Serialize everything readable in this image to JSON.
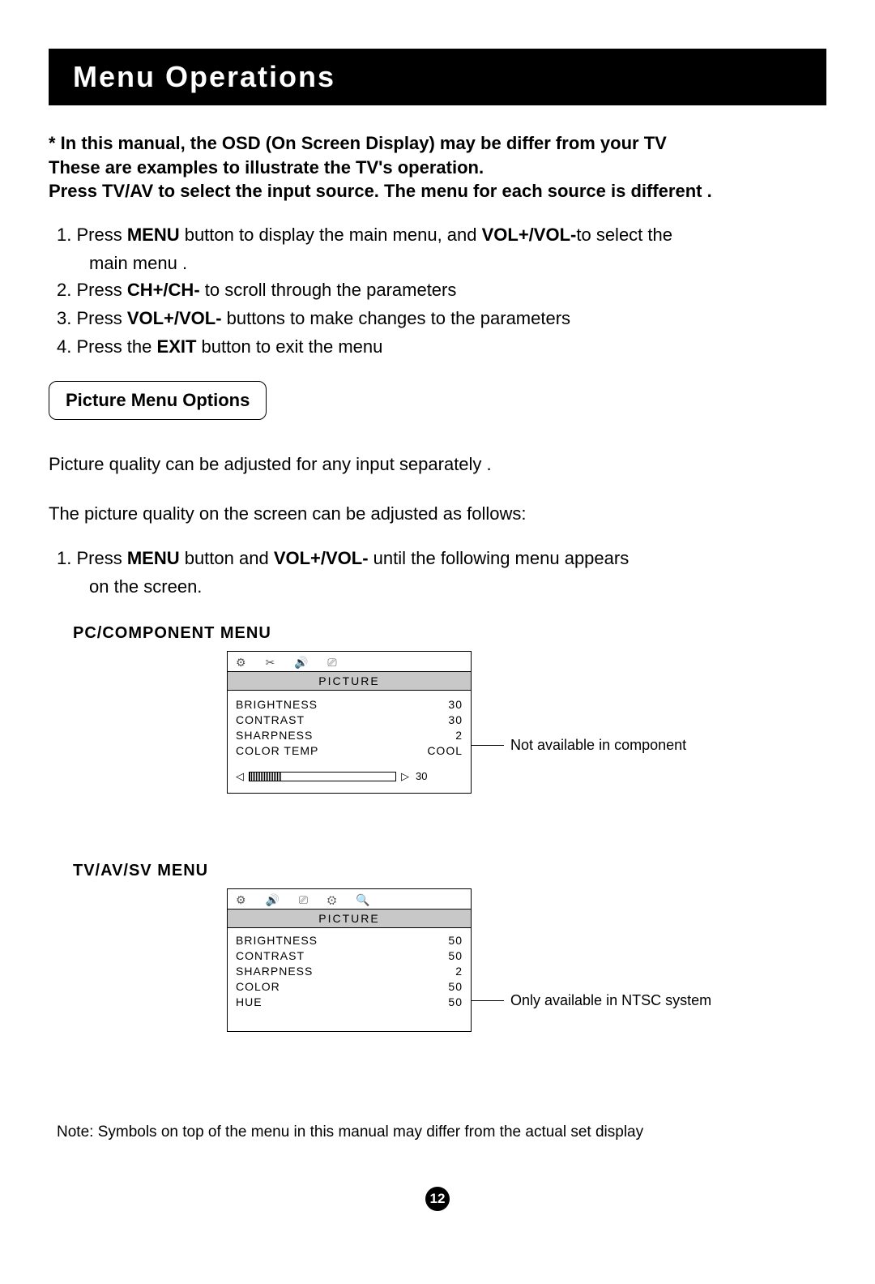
{
  "title": "Menu Operations",
  "intro_bold_1": "* In this manual, the OSD (On Screen Display) may be differ from your TV",
  "intro_bold_2": "These are examples to illustrate the TV's operation.",
  "intro_bold_3": "Press TV/AV to select the input source. The menu for each source is different .",
  "steps": {
    "s1_a": "1. Press ",
    "s1_b": "MENU",
    "s1_c": " button to  display the main menu, and ",
    "s1_d": "VOL+/VOL-",
    "s1_e": "to select the",
    "s1_sub": "main menu .",
    "s2_a": "2. Press ",
    "s2_b": "CH+/CH-",
    "s2_c": " to scroll through the parameters",
    "s3_a": "3. Press ",
    "s3_b": "VOL+/VOL-",
    "s3_c": " buttons to make changes to the parameters",
    "s4_a": "4. Press the ",
    "s4_b": "EXIT",
    "s4_c": " button to exit the menu"
  },
  "section_heading": "Picture Menu Options",
  "para1": "Picture quality can be adjusted for any input separately .",
  "para2": "The picture quality on the screen can be adjusted as follows:",
  "sub1_a": "1. Press ",
  "sub1_b": "MENU",
  "sub1_c": " button and ",
  "sub1_d": "VOL+/VOL-",
  "sub1_e": " until the following menu appears",
  "sub1_sub": "on the screen.",
  "pc_menu_label": "PC/COMPONENT MENU",
  "tv_menu_label": "TV/AV/SV MENU",
  "osd_header": "PICTURE",
  "pc_menu": {
    "rows": [
      {
        "label": "BRIGHTNESS",
        "value": "30"
      },
      {
        "label": "CONTRAST",
        "value": "30"
      },
      {
        "label": "SHARPNESS",
        "value": "2"
      },
      {
        "label": "COLOR TEMP",
        "value": "COOL"
      }
    ],
    "slider_value": "30",
    "callout": "Not available in component"
  },
  "tv_menu": {
    "rows": [
      {
        "label": "BRIGHTNESS",
        "value": "50"
      },
      {
        "label": "CONTRAST",
        "value": "50"
      },
      {
        "label": "SHARPNESS",
        "value": "2"
      },
      {
        "label": "COLOR",
        "value": "50"
      },
      {
        "label": "HUE",
        "value": "50"
      }
    ],
    "callout": "Only available in NTSC system"
  },
  "footnote": "Note: Symbols on top of the menu in this manual may differ from the actual set display",
  "page_number": "12",
  "icons_row": "⚙ ✂ 🔊 ⎚",
  "icons_row2": "⚙ 🔊 ⎚ ⚙ 🔍"
}
